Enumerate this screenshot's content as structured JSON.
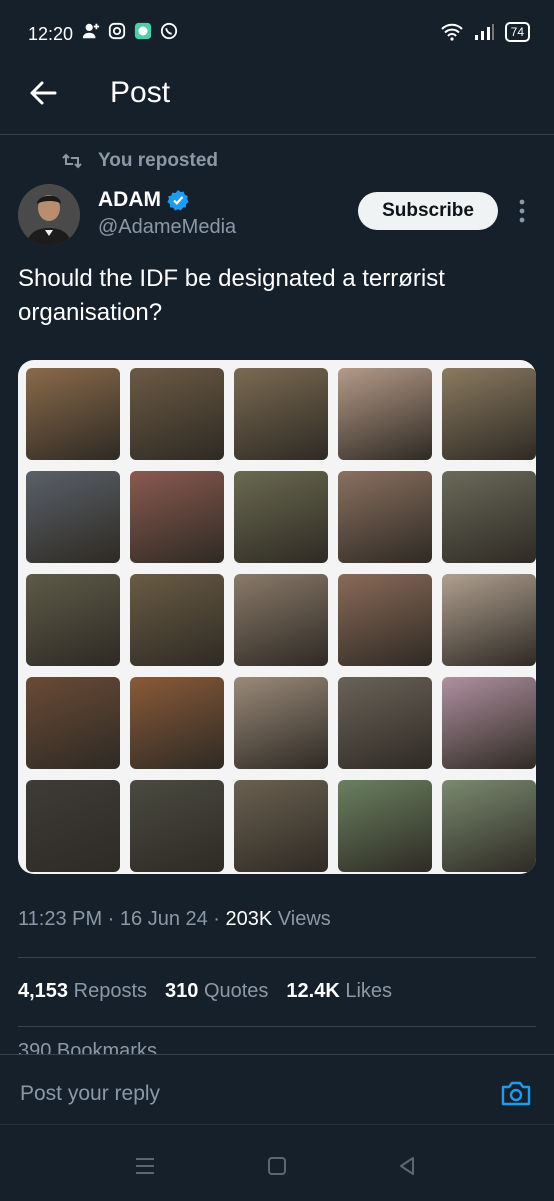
{
  "status_bar": {
    "time": "12:20",
    "battery": "74",
    "left_icons": [
      "person-add-icon",
      "instagram-icon",
      "messenger-icon",
      "whatsapp-icon"
    ],
    "right_icons": [
      "wifi-icon",
      "signal-icon",
      "battery-icon"
    ]
  },
  "header": {
    "title": "Post",
    "back_icon": "arrow-left-icon"
  },
  "repost": {
    "label": "You reposted",
    "icon": "repost-icon"
  },
  "author": {
    "name": "ADAM",
    "handle": "@AdameMedia",
    "verified": true,
    "subscribe_label": "Subscribe"
  },
  "post": {
    "text": "Should the IDF be designated a terrørist organisation?",
    "media_thumbnail_colors": [
      "#8a6a4a",
      "#6b5a44",
      "#7a6a52",
      "#b59a88",
      "#8a7a60",
      "#5a6068",
      "#8a5a50",
      "#6a6a50",
      "#8a7060",
      "#6a6a5a",
      "#5e5a48",
      "#6a5c44",
      "#8a7a6a",
      "#8a6a58",
      "#b0a090",
      "#6a4a36",
      "#8a5a38",
      "#9a8a7a",
      "#6a6258",
      "#b090a0",
      "#3e3c38",
      "#4a4a40",
      "#6a6050",
      "#6a8060",
      "#7a8a70"
    ],
    "timestamp": "11:23 PM · 16 Jun 24 · ",
    "views_count": "203K",
    "views_label": " Views"
  },
  "stats": {
    "reposts_count": "4,153",
    "reposts_label": "Reposts",
    "quotes_count": "310",
    "quotes_label": "Quotes",
    "likes_count": "12.4K",
    "likes_label": "Likes",
    "bookmarks_peek": "390 Bookmarks"
  },
  "reply": {
    "placeholder": "Post your reply",
    "camera_icon": "camera-icon"
  },
  "accent_color": "#1d9bf0"
}
